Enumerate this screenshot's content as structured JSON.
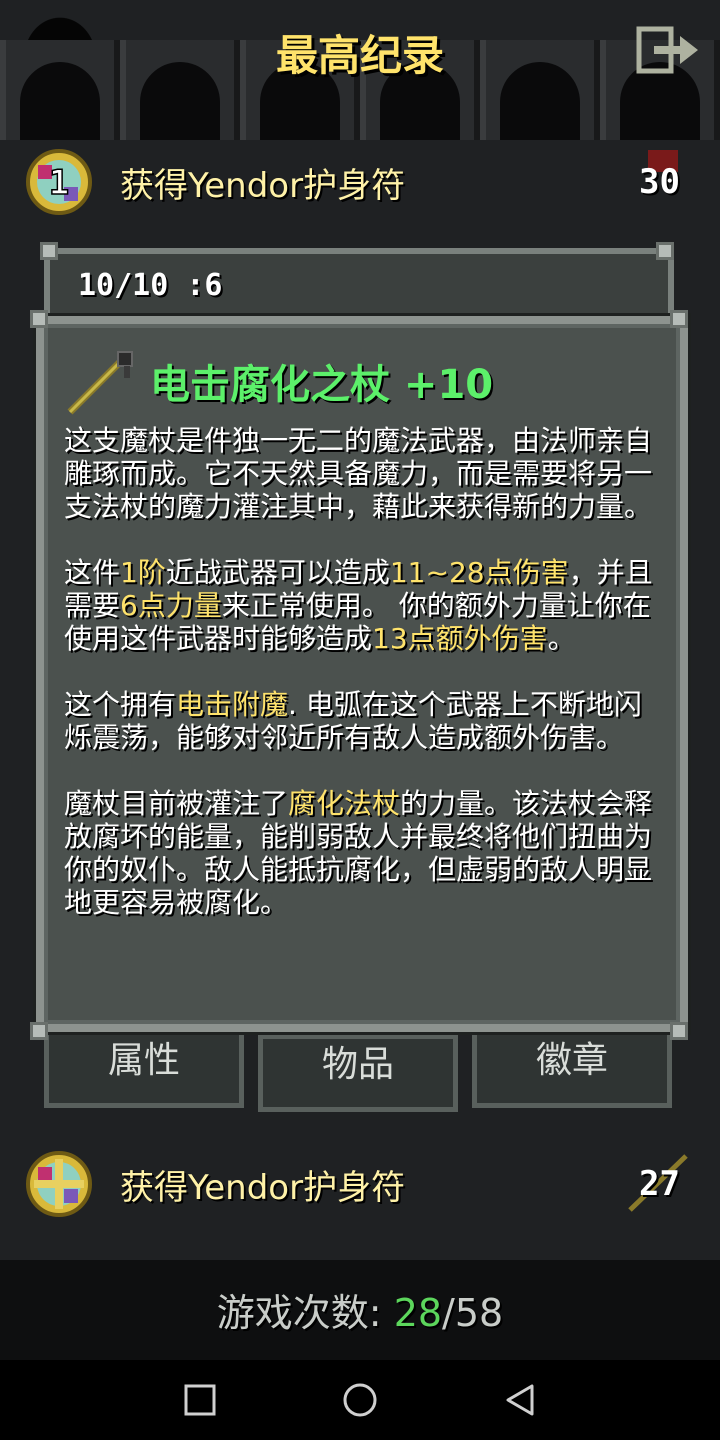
{
  "title": "最高纪录",
  "rows": [
    {
      "medal_number": "1",
      "label": "获得Yendor护身符",
      "score": "30"
    },
    {
      "medal_number": "",
      "label": "获得Yendor护身符",
      "score": "27"
    }
  ],
  "bag_header": "10/10 :6",
  "item": {
    "name": "电击腐化之杖 +10",
    "paragraphs": [
      [
        {
          "t": "这支魔杖是件独一无二的魔法武器，由法师亲自雕琢而成。它不天然具备魔力，而是需要将另一支法杖的魔力灌注其中，藉此来获得新的力量。"
        }
      ],
      [
        {
          "t": "这件"
        },
        {
          "t": "1阶",
          "h": true
        },
        {
          "t": "近战武器可以造成"
        },
        {
          "t": "11~28点伤害",
          "h": true
        },
        {
          "t": "，并且需要"
        },
        {
          "t": "6点力量",
          "h": true
        },
        {
          "t": "来正常使用。 你的额外力量让你在使用这件武器时能够造成"
        },
        {
          "t": "13点额外伤害",
          "h": true
        },
        {
          "t": "。"
        }
      ],
      [
        {
          "t": "这个拥有"
        },
        {
          "t": "电击附魔",
          "h": true
        },
        {
          "t": ". 电弧在这个武器上不断地闪烁震荡，能够对邻近所有敌人造成额外伤害。"
        }
      ],
      [
        {
          "t": "魔杖目前被灌注了"
        },
        {
          "t": "腐化法杖",
          "h": true
        },
        {
          "t": "的力量。该法杖会释放腐坏的能量，能削弱敌人并最终将他们扭曲为你的奴仆。敌人能抵抗腐化，但虚弱的敌人明显地更容易被腐化。"
        }
      ]
    ]
  },
  "tabs": [
    "属性",
    "物品",
    "徽章"
  ],
  "games": {
    "label": "游戏次数:",
    "current": "28",
    "separator": "/",
    "total": "58"
  },
  "colors": {
    "title": "#ffe36b",
    "item_name": "#5cf06a",
    "highlight": "#ffe36b",
    "games_current": "#5cd65c"
  }
}
